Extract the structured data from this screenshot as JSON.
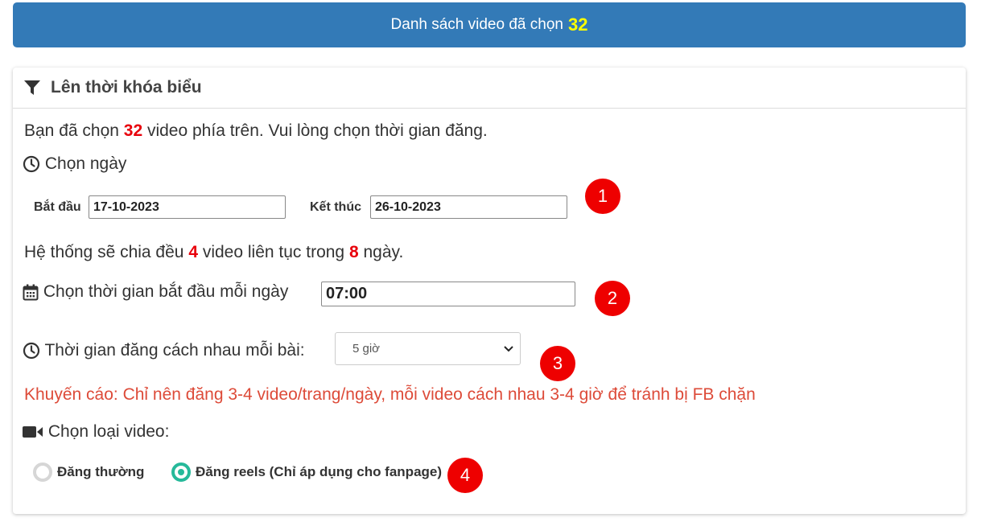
{
  "banner": {
    "text": "Danh sách video đã chọn",
    "count": "32"
  },
  "panel": {
    "title": "Lên thời khóa biểu"
  },
  "intro": {
    "prefix": "Bạn đã chọn ",
    "count": "32",
    "suffix": " video phía trên. Vui lòng chọn thời gian đăng."
  },
  "date_section": {
    "label": "Chọn ngày"
  },
  "start": {
    "label": "Bắt đầu",
    "value": "17-10-2023"
  },
  "end": {
    "label": "Kết thúc",
    "value": "26-10-2023"
  },
  "distribution": {
    "prefix": "Hệ thống sẽ chia đều ",
    "per_day": "4",
    "middle": " video liên tục trong ",
    "days": "8",
    "suffix": " ngày."
  },
  "start_time": {
    "label": "Chọn thời gian bắt đầu mỗi ngày",
    "value": "07:00"
  },
  "interval": {
    "label": "Thời gian đăng cách nhau mỗi bài:",
    "selected": "5 giờ"
  },
  "warning": "Khuyến cáo: Chỉ nên đăng 3-4 video/trang/ngày, mỗi video cách nhau 3-4 giờ để tránh bị FB chặn",
  "video_type": {
    "label": "Chọn loại video:",
    "options": [
      {
        "label": "Đăng thường",
        "selected": false
      },
      {
        "label": "Đăng reels (Chỉ áp dụng cho fanpage)",
        "selected": true
      }
    ]
  },
  "badges": [
    "1",
    "2",
    "3",
    "4"
  ],
  "colors": {
    "banner": "#337ab7",
    "count_highlight": "#ffff00",
    "number_red": "#e8000b",
    "warning": "#dd4b39",
    "radio_accent": "#26b99a",
    "badge": "#ee0000"
  }
}
